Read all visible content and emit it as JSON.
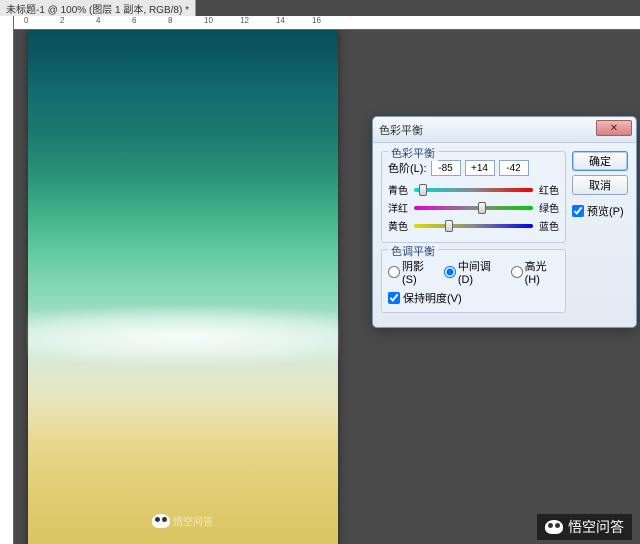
{
  "docTab": "未标题-1 @ 100% (图层 1 副本, RGB/8) *",
  "ruler": {
    "marks": [
      "0",
      "2",
      "4",
      "6",
      "8",
      "10",
      "12",
      "14",
      "16"
    ]
  },
  "watermark": {
    "text": "悟空问答"
  },
  "dialog": {
    "title": "色彩平衡",
    "buttons": {
      "ok": "确定",
      "cancel": "取消"
    },
    "preview": {
      "label": "预览(P)",
      "checked": true
    },
    "colorBalance": {
      "groupTitle": "色彩平衡",
      "levelsLabel": "色阶(L):",
      "levels": [
        "-85",
        "+14",
        "-42"
      ],
      "sliders": [
        {
          "left": "青色",
          "right": "红色",
          "value": -85
        },
        {
          "left": "洋红",
          "right": "绿色",
          "value": 14
        },
        {
          "left": "黄色",
          "right": "蓝色",
          "value": -42
        }
      ]
    },
    "toneBalance": {
      "groupTitle": "色调平衡",
      "options": {
        "shadows": "阴影(S)",
        "midtones": "中间调(D)",
        "highlights": "高光(H)"
      },
      "selected": "midtones",
      "preserveLum": {
        "label": "保持明度(V)",
        "checked": true
      }
    }
  }
}
